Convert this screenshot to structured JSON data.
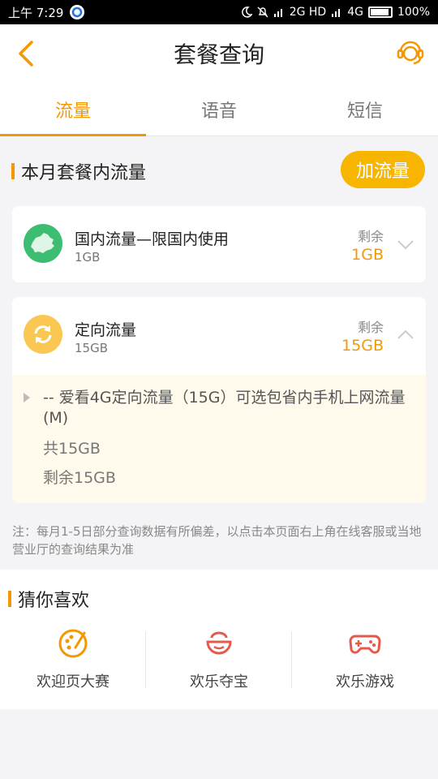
{
  "status_bar": {
    "time": "上午 7:29",
    "network": "2G HD",
    "network2": "4G",
    "battery": "100%"
  },
  "header": {
    "title": "套餐查询"
  },
  "tabs": [
    {
      "label": "流量",
      "active": true
    },
    {
      "label": "语音",
      "active": false
    },
    {
      "label": "短信",
      "active": false
    }
  ],
  "section": {
    "title": "本月套餐内流量",
    "add_button": "加流量"
  },
  "plans": [
    {
      "name": "国内流量—限国内使用",
      "total": "1GB",
      "remaining_label": "剩余",
      "remaining": "1GB",
      "icon": "china-map-icon",
      "expanded": false
    },
    {
      "name": "定向流量",
      "total": "15GB",
      "remaining_label": "剩余",
      "remaining": "15GB",
      "icon": "refresh-icon",
      "expanded": true,
      "detail": {
        "name": "-- 爱看4G定向流量（15G）可选包省内手机上网流量(M)",
        "total": "共15GB",
        "left": "剩余15GB"
      }
    }
  ],
  "note": "注：每月1-5日部分查询数据有所偏差，以点击本页面右上角在线客服或当地营业厅的查询结果为准",
  "guess": {
    "title": "猜你喜欢",
    "items": [
      {
        "label": "欢迎页大赛",
        "icon": "palette-icon"
      },
      {
        "label": "欢乐夺宝",
        "icon": "treasure-bowl-icon"
      },
      {
        "label": "欢乐游戏",
        "icon": "gamepad-icon"
      }
    ]
  },
  "colors": {
    "accent": "#f39800",
    "button": "#f7b500",
    "map_green": "#3dbd72",
    "refresh_yellow": "#f9c752",
    "game_red": "#e8584a"
  }
}
